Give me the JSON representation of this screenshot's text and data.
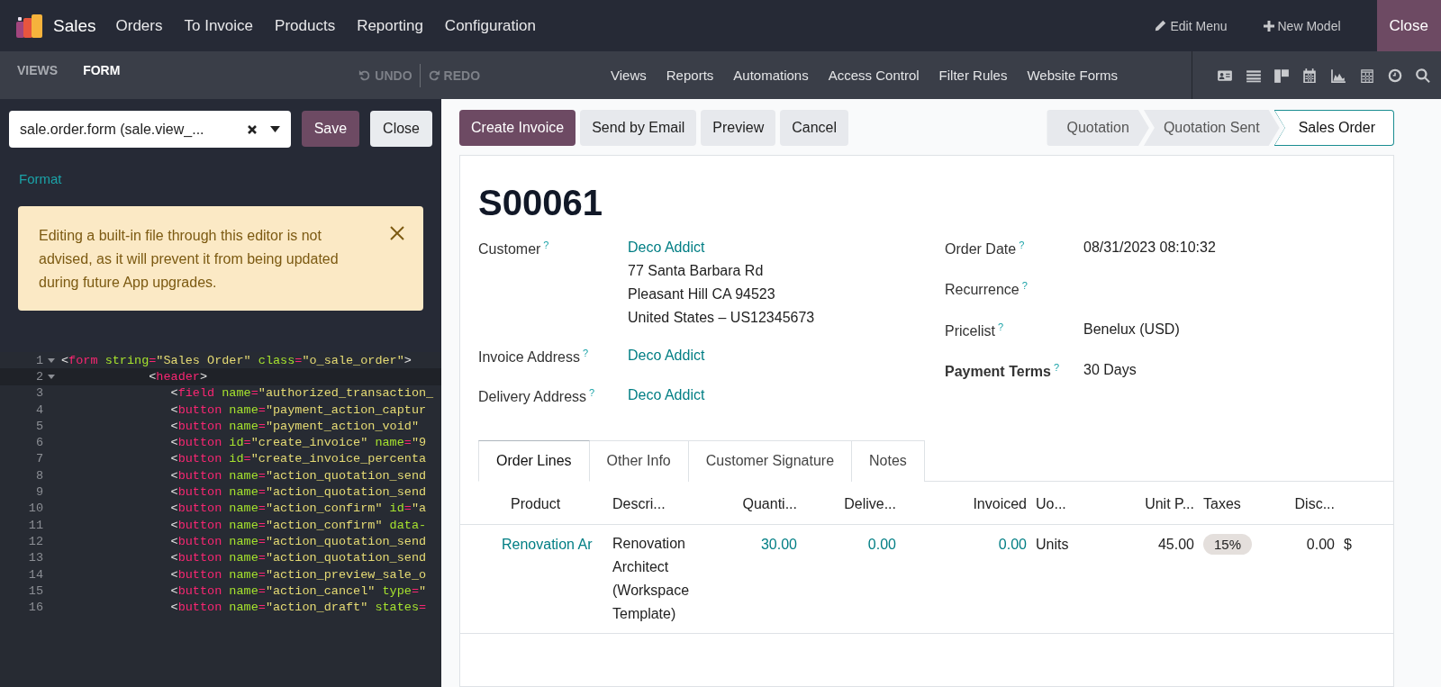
{
  "top_bar": {
    "app_name": "Sales",
    "menu": [
      "Orders",
      "To Invoice",
      "Products",
      "Reporting",
      "Configuration"
    ],
    "actions": [
      {
        "kind": "edit",
        "label": "Edit Menu"
      },
      {
        "kind": "new",
        "label": "New Model"
      }
    ],
    "close": "Close"
  },
  "sub_bar": {
    "tabs": [
      {
        "label": "VIEWS",
        "selected": false
      },
      {
        "label": "FORM",
        "selected": true
      }
    ],
    "undo": {
      "label": "UNDO",
      "disabled": true
    },
    "redo": {
      "label": "REDO",
      "disabled": true
    },
    "menu": [
      "Views",
      "Reports",
      "Automations",
      "Access Control",
      "Filter Rules",
      "Website Forms"
    ]
  },
  "editor": {
    "view_select": {
      "value": "sale.order.form (sale.view_..."
    },
    "save": "Save",
    "close": "Close",
    "format_link": "Format",
    "alert": "Editing a built-in file through this editor is not advised, as it will prevent it from being updated during future App upgrades.",
    "code": [
      {
        "n": "1",
        "text": "<form string=\"Sales Order\" class=\"o_sale_order\">",
        "active": false,
        "fold": true
      },
      {
        "n": "2",
        "text": "            <header>",
        "active": true,
        "fold": true
      },
      {
        "n": "3",
        "text": "               <field name=\"authorized_transaction_",
        "active": false,
        "fold": false
      },
      {
        "n": "4",
        "text": "               <button name=\"payment_action_captur",
        "active": false,
        "fold": false
      },
      {
        "n": "5",
        "text": "               <button name=\"payment_action_void\"",
        "active": false,
        "fold": false
      },
      {
        "n": "6",
        "text": "               <button id=\"create_invoice\" name=\"9",
        "active": false,
        "fold": false
      },
      {
        "n": "7",
        "text": "               <button id=\"create_invoice_percenta",
        "active": false,
        "fold": false
      },
      {
        "n": "8",
        "text": "               <button name=\"action_quotation_send",
        "active": false,
        "fold": false
      },
      {
        "n": "9",
        "text": "               <button name=\"action_quotation_send",
        "active": false,
        "fold": false
      },
      {
        "n": "10",
        "text": "               <button name=\"action_confirm\" id=\"a",
        "active": false,
        "fold": false
      },
      {
        "n": "11",
        "text": "               <button name=\"action_confirm\" data-",
        "active": false,
        "fold": false
      },
      {
        "n": "12",
        "text": "               <button name=\"action_quotation_send",
        "active": false,
        "fold": false
      },
      {
        "n": "13",
        "text": "               <button name=\"action_quotation_send",
        "active": false,
        "fold": false
      },
      {
        "n": "14",
        "text": "               <button name=\"action_preview_sale_o",
        "active": false,
        "fold": false
      },
      {
        "n": "15",
        "text": "               <button name=\"action_cancel\" type=\"",
        "active": false,
        "fold": false
      },
      {
        "n": "16",
        "text": "               <button name=\"action_draft\" states=",
        "active": false,
        "fold": false
      }
    ]
  },
  "form": {
    "buttons": [
      {
        "label": "Create Invoice",
        "primary": true
      },
      {
        "label": "Send by Email",
        "primary": false
      },
      {
        "label": "Preview",
        "primary": false
      },
      {
        "label": "Cancel",
        "primary": false
      }
    ],
    "status_steps": [
      {
        "label": "Quotation",
        "selected": false
      },
      {
        "label": "Quotation Sent",
        "selected": false
      },
      {
        "label": "Sales Order",
        "selected": true
      }
    ],
    "name": "S00061",
    "left_fields": [
      {
        "label": "Customer",
        "help": "?",
        "bold": false,
        "value": "Deco Addict",
        "lines": [
          "77 Santa Barbara Rd",
          "Pleasant Hill CA 94523",
          "United States – US12345673"
        ]
      },
      {
        "label": "Invoice Address",
        "help": "?",
        "bold": false,
        "value": "Deco Addict"
      },
      {
        "label": "Delivery Address",
        "help": "?",
        "bold": false,
        "value": "Deco Addict"
      }
    ],
    "right_fields": [
      {
        "label": "Order Date",
        "help": "?",
        "bold": false,
        "value": "08/31/2023 08:10:32"
      },
      {
        "label": "Recurrence",
        "help": "?",
        "bold": false
      },
      {
        "label": "Pricelist",
        "help": "?",
        "bold": false,
        "value": "Benelux (USD)"
      },
      {
        "label": "Payment Terms",
        "help": "?",
        "bold": true,
        "value": "30 Days"
      }
    ],
    "tabs": [
      {
        "label": "Order Lines",
        "selected": true
      },
      {
        "label": "Other Info",
        "selected": false
      },
      {
        "label": "Customer Signature",
        "selected": false
      },
      {
        "label": "Notes",
        "selected": false
      }
    ],
    "table": {
      "columns": [
        {
          "label": "Product",
          "kind": "text"
        },
        {
          "label": "Descri...",
          "kind": "text"
        },
        {
          "label": "Quanti...",
          "kind": "number"
        },
        {
          "label": "Delive...",
          "kind": "number"
        },
        {
          "label": "Invoiced",
          "kind": "number"
        },
        {
          "label": "Uo...",
          "kind": "text"
        },
        {
          "label": "Unit P...",
          "kind": "number"
        },
        {
          "label": "Taxes",
          "kind": "text"
        },
        {
          "label": "Disc...",
          "kind": "number"
        }
      ],
      "rows": [
        {
          "cells": [
            {
              "text": "Renovation Ar",
              "kind": "link"
            },
            {
              "text": "Renovation Architect (Workspace Template)",
              "kind": "text"
            },
            {
              "text": "30.00",
              "kind": "link-number"
            },
            {
              "text": "0.00",
              "kind": "link-number"
            },
            {
              "text": "0.00",
              "kind": "link-number"
            },
            {
              "text": "Units",
              "kind": "text"
            },
            {
              "text": "45.00",
              "kind": "number"
            },
            {
              "text": "15%",
              "kind": "tag"
            },
            {
              "text": "0.00",
              "kind": "number"
            },
            {
              "text": "$",
              "kind": "text"
            }
          ]
        }
      ]
    }
  }
}
